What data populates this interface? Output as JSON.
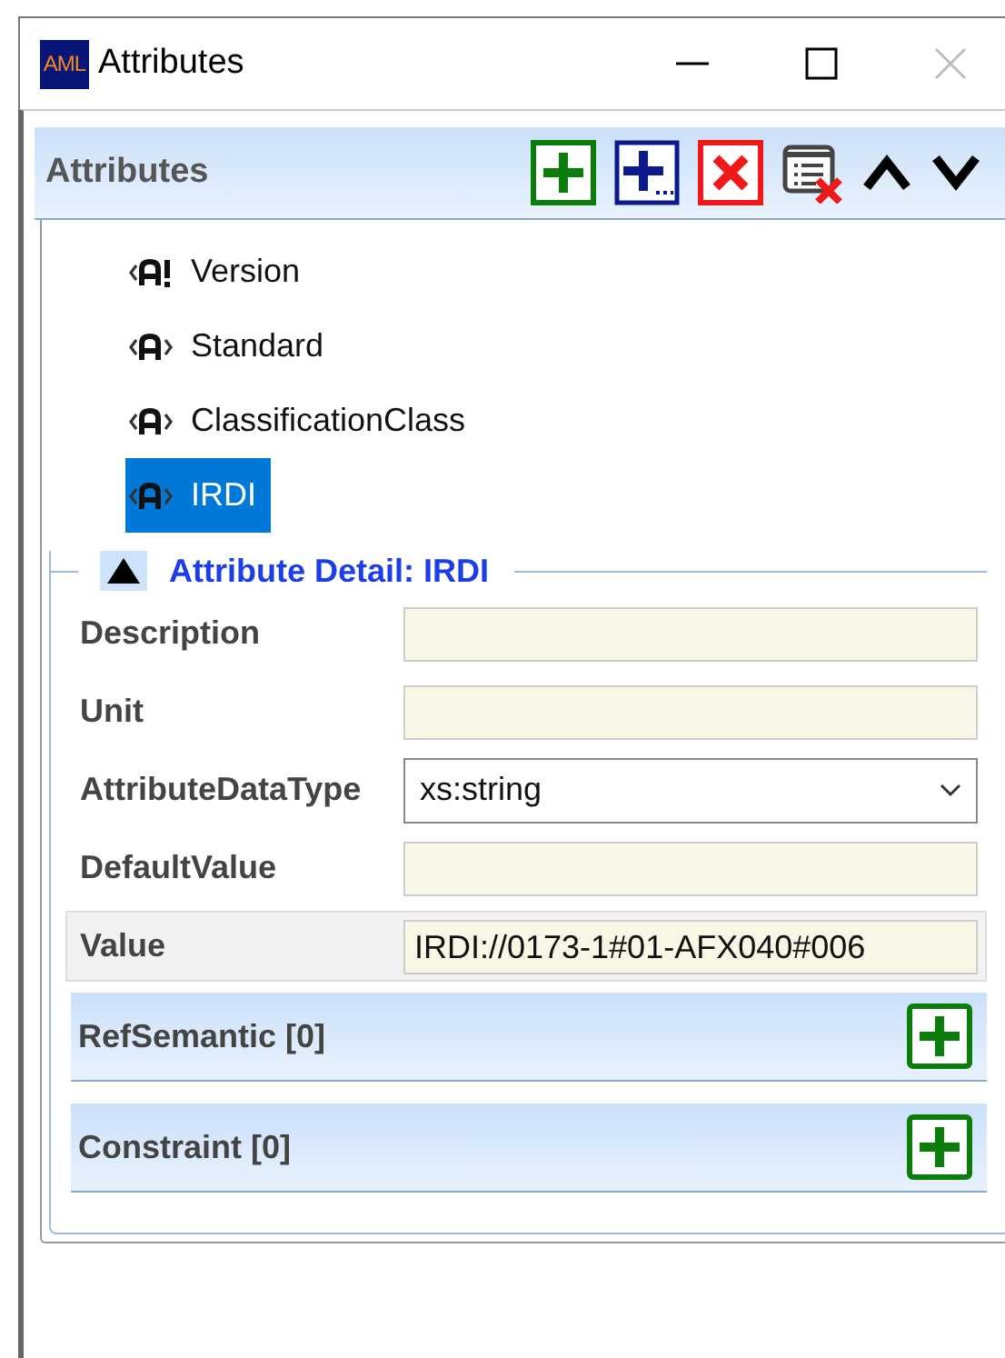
{
  "window": {
    "logo": "AML",
    "title": "Attributes"
  },
  "toolbar": {
    "title": "Attributes",
    "buttons": [
      {
        "kind": "add"
      },
      {
        "kind": "add-more"
      },
      {
        "kind": "delete"
      },
      {
        "kind": "clear-list"
      },
      {
        "kind": "up"
      },
      {
        "kind": "down"
      }
    ]
  },
  "tree": {
    "items": [
      {
        "label": "Version",
        "kind": "required",
        "selected": false
      },
      {
        "label": "Standard",
        "kind": "attribute",
        "selected": false
      },
      {
        "label": "ClassificationClass",
        "kind": "attribute",
        "selected": false
      },
      {
        "label": "IRDI",
        "kind": "attribute",
        "selected": true
      }
    ]
  },
  "detail": {
    "title": "Attribute Detail: IRDI",
    "expanded": true,
    "fields": [
      {
        "label": "Description",
        "kind": "text",
        "selected": false
      },
      {
        "label": "Unit",
        "kind": "text",
        "selected": false
      },
      {
        "label": "AttributeDataType",
        "kind": "select",
        "value": "xs:string",
        "selected": false
      },
      {
        "label": "DefaultValue",
        "kind": "text",
        "selected": false
      },
      {
        "label": "Value",
        "kind": "text",
        "value": "IRDI://0173-1#01-AFX040#006",
        "selected": true
      }
    ],
    "sections": [
      {
        "title": "RefSemantic [0]"
      },
      {
        "title": "Constraint [0]"
      }
    ]
  }
}
